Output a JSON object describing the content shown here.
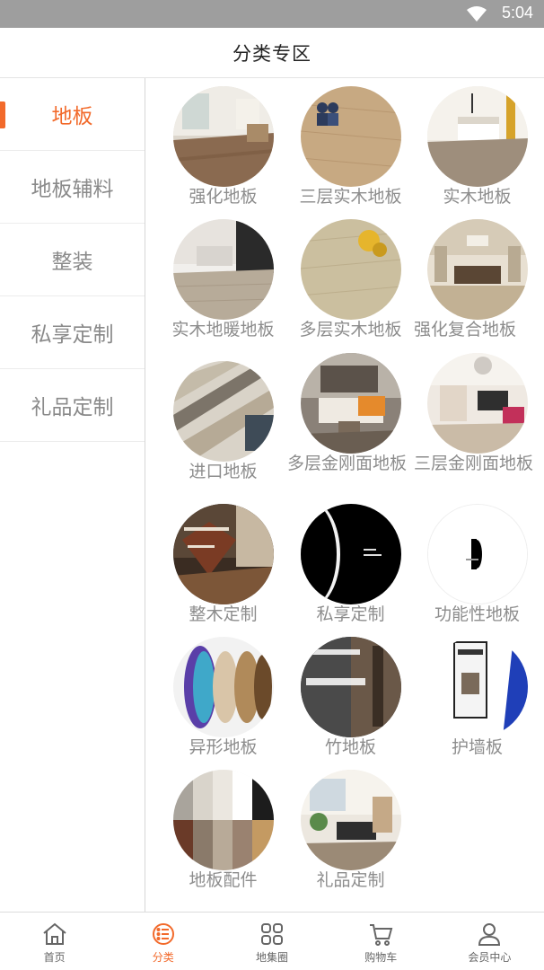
{
  "status": {
    "time": "5:04"
  },
  "header": {
    "title": "分类专区"
  },
  "sidebar": {
    "items": [
      {
        "label": "地板",
        "active": true
      },
      {
        "label": "地板辅料",
        "active": false
      },
      {
        "label": "整装",
        "active": false
      },
      {
        "label": "私享定制",
        "active": false
      },
      {
        "label": "礼品定制",
        "active": false
      }
    ]
  },
  "products": [
    {
      "label": "强化地板"
    },
    {
      "label": "三层实木地板"
    },
    {
      "label": "实木地板"
    },
    {
      "label": "实木地暖地板"
    },
    {
      "label": "多层实木地板"
    },
    {
      "label": "强化复合地板"
    },
    {
      "label": "进口地板"
    },
    {
      "label": "多层金刚面地板"
    },
    {
      "label": "三层金刚面地板"
    },
    {
      "label": "整木定制"
    },
    {
      "label": "私享定制"
    },
    {
      "label": "功能性地板"
    },
    {
      "label": "异形地板"
    },
    {
      "label": "竹地板"
    },
    {
      "label": "护墙板"
    },
    {
      "label": "地板配件"
    },
    {
      "label": "礼品定制"
    }
  ],
  "tabbar": {
    "items": [
      {
        "label": "首页",
        "icon": "home-icon",
        "active": false
      },
      {
        "label": "分类",
        "icon": "category-icon",
        "active": true
      },
      {
        "label": "地集圈",
        "icon": "grid-icon",
        "active": false
      },
      {
        "label": "购物车",
        "icon": "cart-icon",
        "active": false
      },
      {
        "label": "会员中心",
        "icon": "user-icon",
        "active": false
      }
    ]
  },
  "colors": {
    "accent": "#f26a2b",
    "status_bar": "#9e9e9e",
    "inactive_text": "#8a8a8a"
  }
}
